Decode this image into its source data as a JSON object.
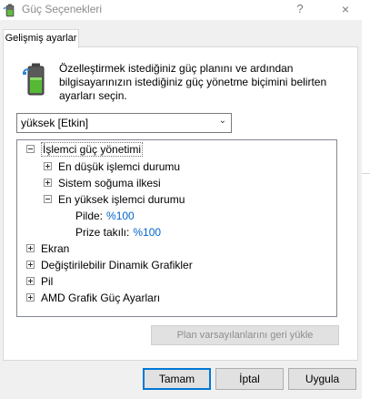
{
  "window": {
    "title": "Güç Seçenekleri",
    "help_glyph": "?",
    "close_glyph": "×",
    "icon": "power-battery-icon"
  },
  "tabs": [
    {
      "label": "Gelişmiş ayarlar",
      "active": true
    }
  ],
  "description": "Özelleştirmek istediğiniz güç planını ve ardından bilgisayarınızın istediğiniz güç yönetme biçimini belirten ayarları seçin.",
  "plan_select": {
    "value": "yüksek [Etkin]"
  },
  "tree": {
    "processor": {
      "label": "İşlemci güç yönetimi",
      "children": {
        "min_state": "En düşük işlemci durumu",
        "cooling": "Sistem soğuma ilkesi",
        "max_state": {
          "label": "En yüksek işlemci durumu",
          "battery_label": "Pilde:",
          "battery_value": "%100",
          "plugged_label": "Prize takılı:",
          "plugged_value": "%100"
        }
      }
    },
    "display": "Ekran",
    "switchable_graphics": "Değiştirilebilir Dinamik Grafikler",
    "battery": "Pil",
    "amd_power": "AMD Grafik Güç Ayarları"
  },
  "restore_button": "Plan varsayılanlarını geri yükle",
  "buttons": {
    "ok": "Tamam",
    "cancel": "İptal",
    "apply": "Uygula"
  },
  "colors": {
    "link_value": "#0066cc",
    "default_button_border": "#0078d7"
  }
}
